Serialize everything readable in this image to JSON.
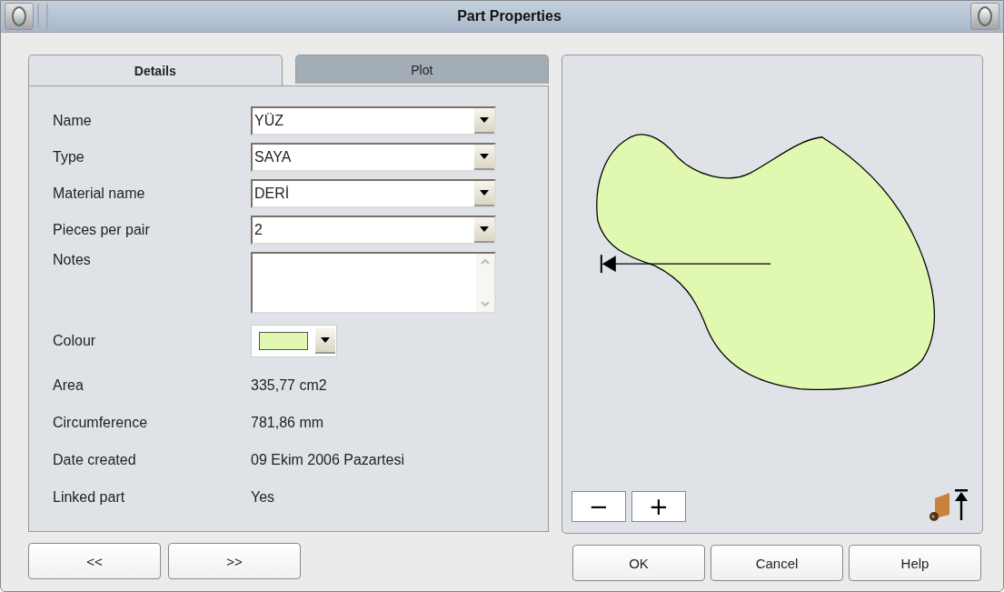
{
  "window": {
    "title": "Part Properties"
  },
  "tabs": [
    {
      "label": "Details",
      "selected": true
    },
    {
      "label": "Plot",
      "selected": false
    }
  ],
  "fields": [
    {
      "kind": "combo",
      "label": "Name",
      "value": "YÜZ"
    },
    {
      "kind": "combo",
      "label": "Type",
      "value": "SAYA"
    },
    {
      "kind": "combo",
      "label": "Material name",
      "value": "DERİ"
    },
    {
      "kind": "combo",
      "label": "Pieces per pair",
      "value": "2"
    },
    {
      "kind": "textarea",
      "label": "Notes"
    },
    {
      "kind": "color",
      "label": "Colour",
      "color": "#e0f8b0"
    },
    {
      "kind": "text",
      "label": "Area",
      "value": "335,77 cm2"
    },
    {
      "kind": "text",
      "label": "Circumference",
      "value": "781,86 mm"
    },
    {
      "kind": "text",
      "label": "Date created",
      "value": "09 Ekim 2006 Pazartesi"
    },
    {
      "kind": "text",
      "label": "Linked part",
      "value": "Yes"
    }
  ],
  "preview": {
    "zoom_buttons": [
      "−",
      "+"
    ]
  },
  "nav_buttons": [
    "<<",
    ">>"
  ],
  "buttons": [
    "OK",
    "Cancel",
    "Help"
  ]
}
